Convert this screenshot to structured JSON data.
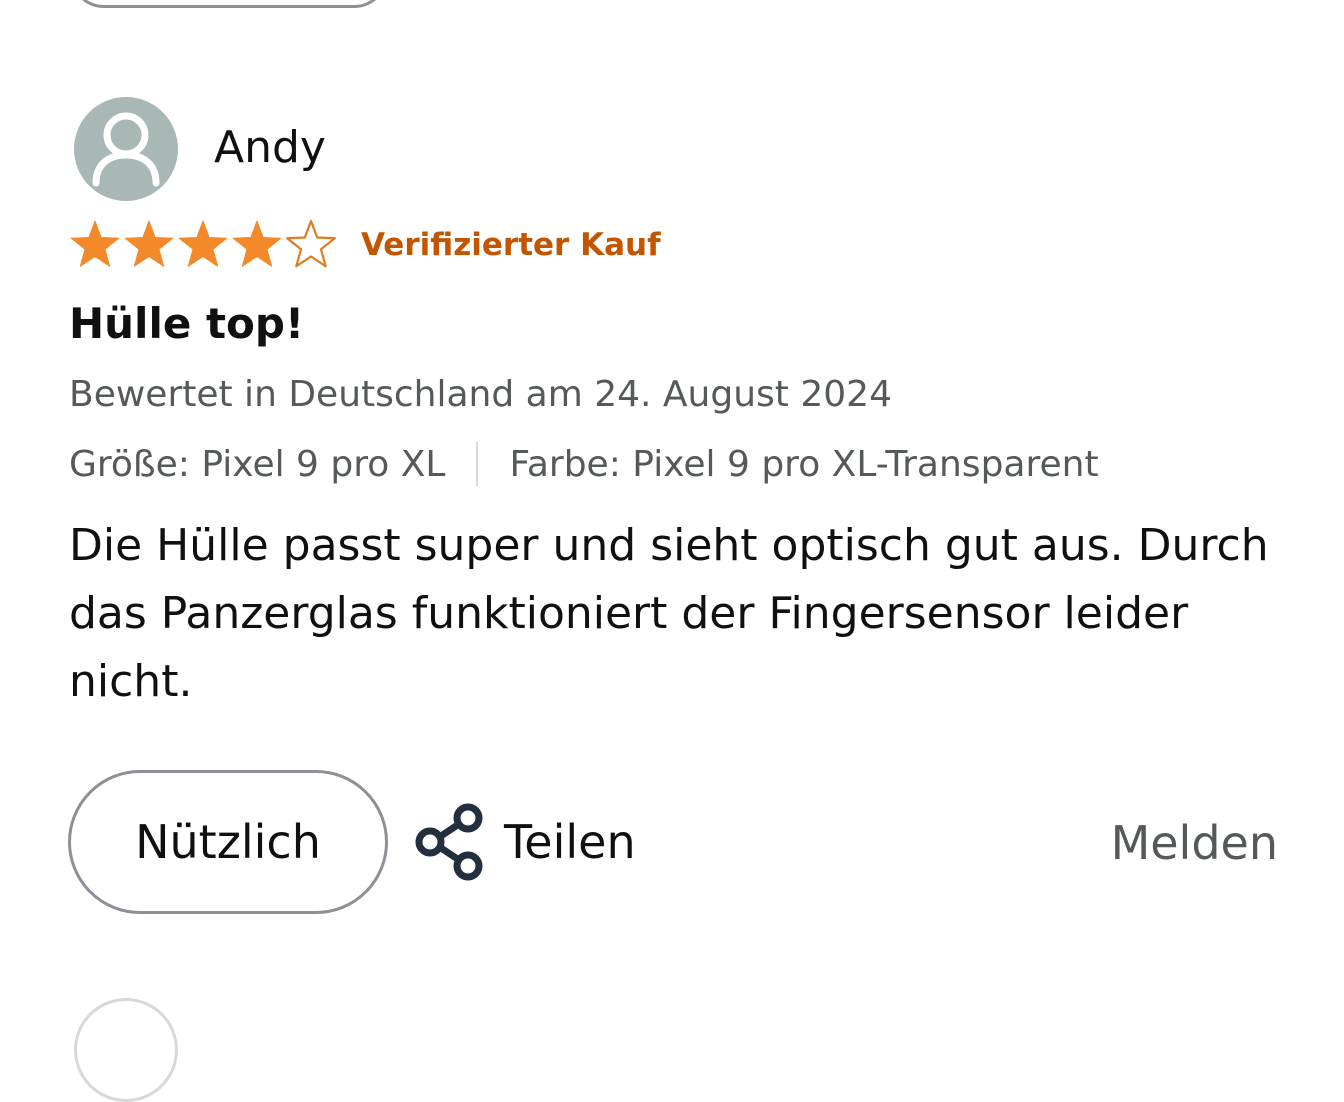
{
  "review": {
    "reviewer_name": "Andy",
    "rating": 4,
    "rating_max": 5,
    "verified_label": "Verifizierter Kauf",
    "title": "Hülle top!",
    "date_line": "Bewertet in Deutschland am 24. August 2024",
    "size_label": "Größe: Pixel 9 pro XL",
    "color_label": "Farbe: Pixel 9 pro XL-Transparent",
    "body": "Die Hülle passt super und sieht optisch gut aus. Durch das Panzerglas funktioniert der Fingersensor leider nicht."
  },
  "actions": {
    "helpful_label": "Nützlich",
    "share_label": "Teilen",
    "report_label": "Melden"
  },
  "colors": {
    "star_filled": "#f3892a",
    "star_stroke": "#e07b1f",
    "verified": "#c45500",
    "avatar_bg": "#a9b7b7",
    "secondary_text": "#565959"
  },
  "icons": {
    "avatar": "user-silhouette-icon",
    "share": "share-nodes-icon",
    "star": "star-icon"
  }
}
